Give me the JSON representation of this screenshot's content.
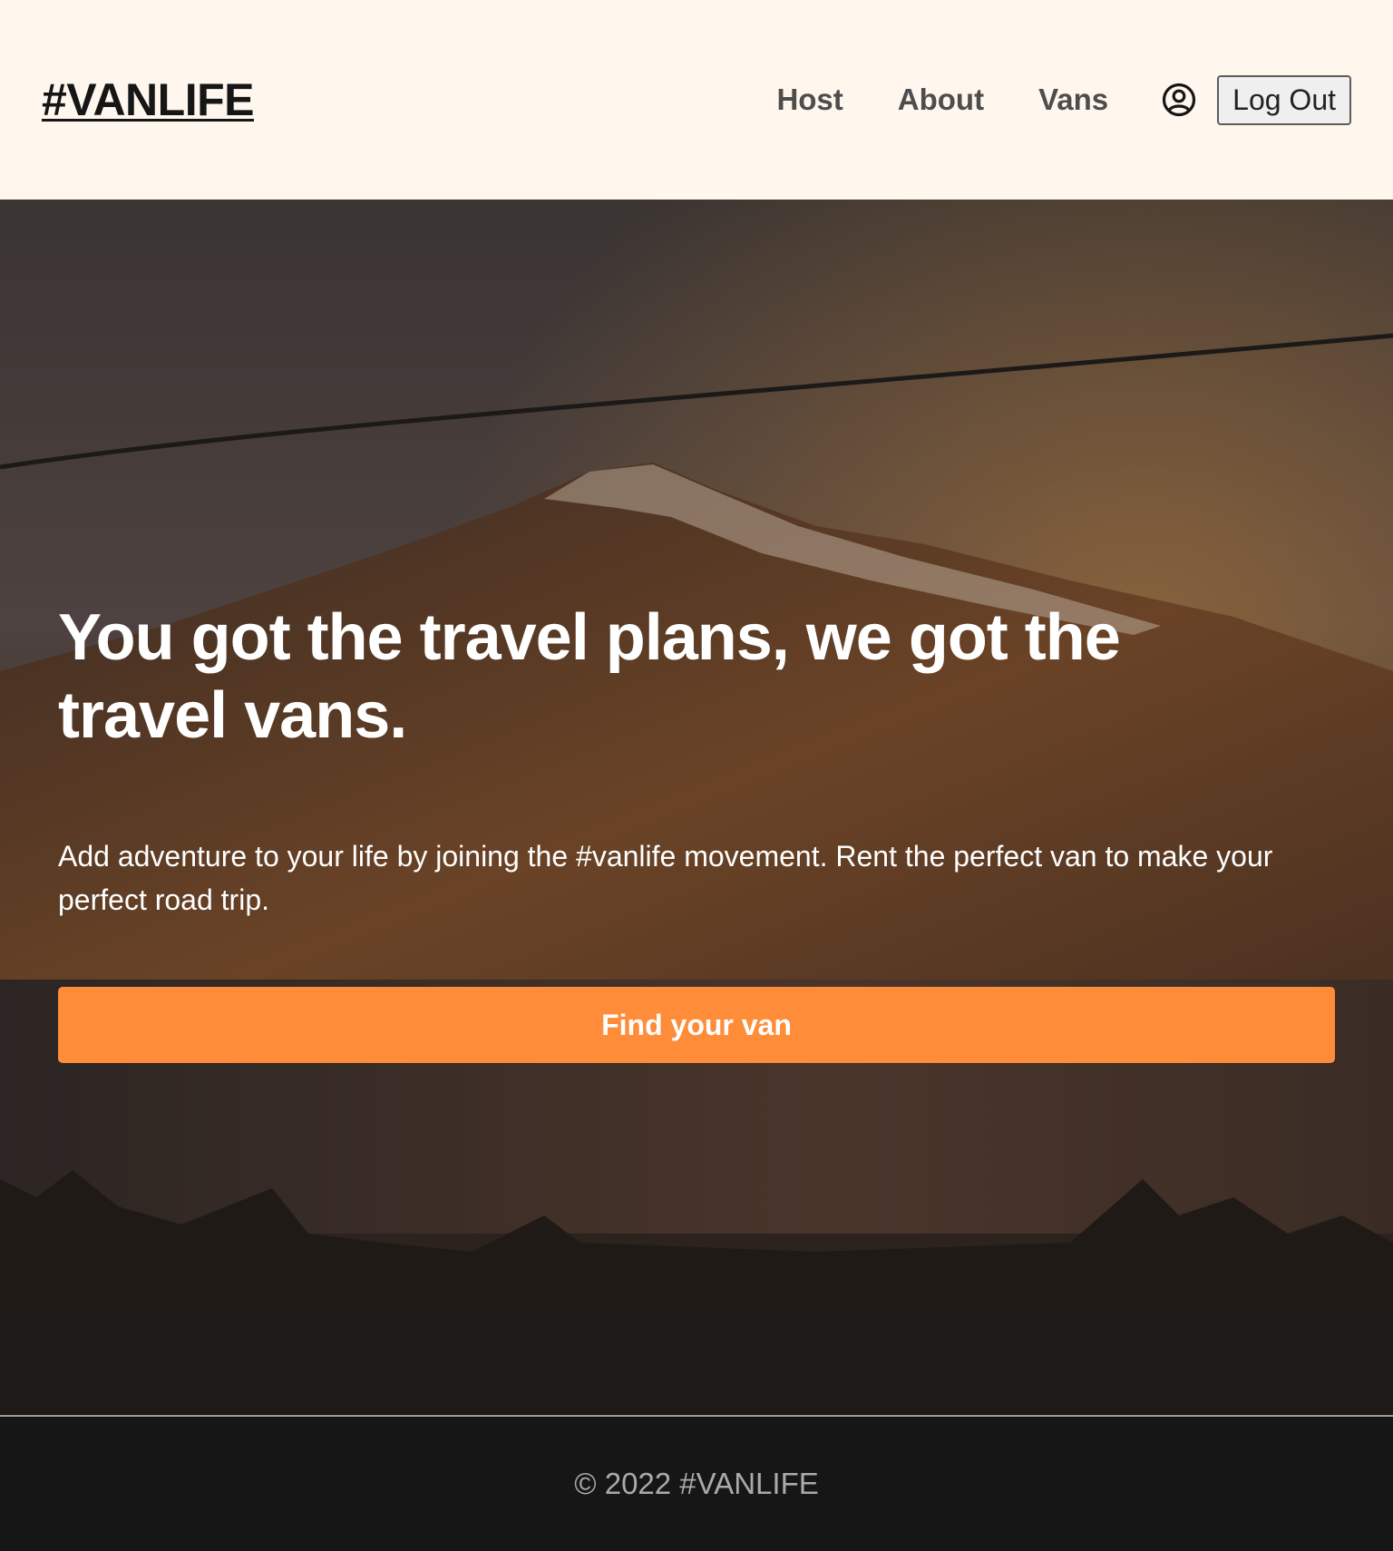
{
  "header": {
    "logo": "#VANLIFE",
    "nav": {
      "host": "Host",
      "about": "About",
      "vans": "Vans"
    },
    "user_icon": "user-circle-icon",
    "logout_label": "Log Out"
  },
  "hero": {
    "title": "You got the travel plans, we got the travel vans.",
    "subtitle": "Add adventure to your life by joining the #vanlife movement. Rent the perfect van to make your perfect road trip.",
    "cta_label": "Find your van"
  },
  "footer": {
    "text": "© 2022 #VANLIFE"
  },
  "colors": {
    "header_bg": "#FFF7ED",
    "accent": "#FF8C38",
    "footer_bg": "#161616",
    "text_dark": "#161616"
  }
}
